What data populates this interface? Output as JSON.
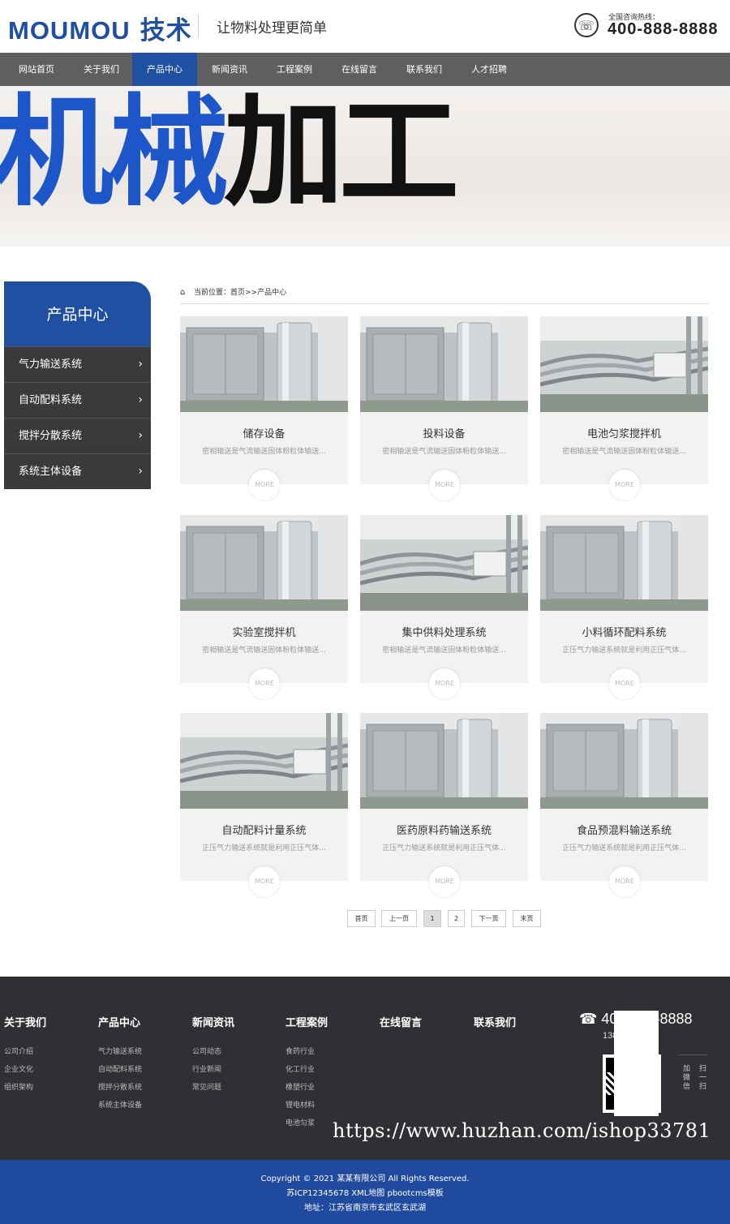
{
  "header": {
    "logo_main": "MOUMOU",
    "logo_sub": "技术",
    "slogan": "让物料处理更简单",
    "hotline_label": "全国咨询热线：",
    "hotline_number": "400-888-8888",
    "phone_icon": "phone-icon"
  },
  "nav": {
    "items": [
      "网站首页",
      "关于我们",
      "产品中心",
      "新闻资讯",
      "工程案例",
      "在线留言",
      "联系我们",
      "人才招聘"
    ],
    "active_index": 2
  },
  "banner": {
    "text_blue": "机械",
    "text_black": "加工"
  },
  "sidebar": {
    "title": "产品中心",
    "items": [
      "气力输送系统",
      "自动配料系统",
      "搅拌分散系统",
      "系统主体设备"
    ]
  },
  "breadcrumb": {
    "text": "当前位置：首页>>产品中心",
    "icon": "home-icon"
  },
  "products": [
    {
      "name": "储存设备",
      "desc": "密相输送是气流输送固体粉粒体输送...",
      "more": "MORE",
      "image": "tank"
    },
    {
      "name": "投料设备",
      "desc": "密相输送是气流输送固体粉粒体输送...",
      "more": "MORE",
      "image": "tank"
    },
    {
      "name": "电池匀浆搅拌机",
      "desc": "密相输送是气流输送固体粉粒体输送...",
      "more": "MORE",
      "image": "pipes"
    },
    {
      "name": "实验室搅拌机",
      "desc": "密相输送是气流输送固体粉粒体输送...",
      "more": "MORE",
      "image": "tank"
    },
    {
      "name": "集中供料处理系统",
      "desc": "密相输送是气流输送固体粉粒体输送...",
      "more": "MORE",
      "image": "pipes"
    },
    {
      "name": "小料循环配料系统",
      "desc": "正压气力输送系统就是利用正压气体...",
      "more": "MORE",
      "image": "tank"
    },
    {
      "name": "自动配料计量系统",
      "desc": "正压气力输送系统就是利用正压气体...",
      "more": "MORE",
      "image": "pipes"
    },
    {
      "name": "医药原料药输送系统",
      "desc": "正压气力输送系统就是利用正压气体...",
      "more": "MORE",
      "image": "tank"
    },
    {
      "name": "食品预混料输送系统",
      "desc": "正压气力输送系统就是利用正压气体...",
      "more": "MORE",
      "image": "tank"
    }
  ],
  "pagination": {
    "first": "首页",
    "prev": "上一页",
    "pages": [
      "1",
      "2"
    ],
    "current": "1",
    "next": "下一页",
    "last": "末页"
  },
  "footer": {
    "columns": [
      {
        "title": "关于我们",
        "links": [
          "公司介绍",
          "企业文化",
          "组织架构"
        ]
      },
      {
        "title": "产品中心",
        "links": [
          "气力输送系统",
          "自动配料系统",
          "搅拌分散系统",
          "系统主体设备"
        ]
      },
      {
        "title": "新闻资讯",
        "links": [
          "公司动态",
          "行业新闻",
          "常见问题"
        ]
      },
      {
        "title": "工程案例",
        "links": [
          "食药行业",
          "化工行业",
          "橡塑行业",
          "锂电材料",
          "电池匀浆"
        ]
      },
      {
        "title": "在线留言",
        "links": []
      },
      {
        "title": "联系我们",
        "links": []
      }
    ],
    "phone": "400-888-8888",
    "mobile": "13888888888",
    "qr_caption_1": "扫一扫",
    "qr_caption_2": "加微信",
    "watermark": "https://www.huzhan.com/ishop33781"
  },
  "copyright": {
    "line1": "Copyright © 2021 某某有限公司 All Rights Reserved.",
    "line2": "苏ICP12345678 XML地图 pbootcms模板",
    "line3": "地址：江苏省南京市玄武区玄武湖"
  },
  "colors": {
    "brand_blue": "#1f50a2",
    "nav_gray": "#5f5f5f",
    "sidebar_dark": "#3a3a3a",
    "footer_dark": "#2e3033"
  }
}
